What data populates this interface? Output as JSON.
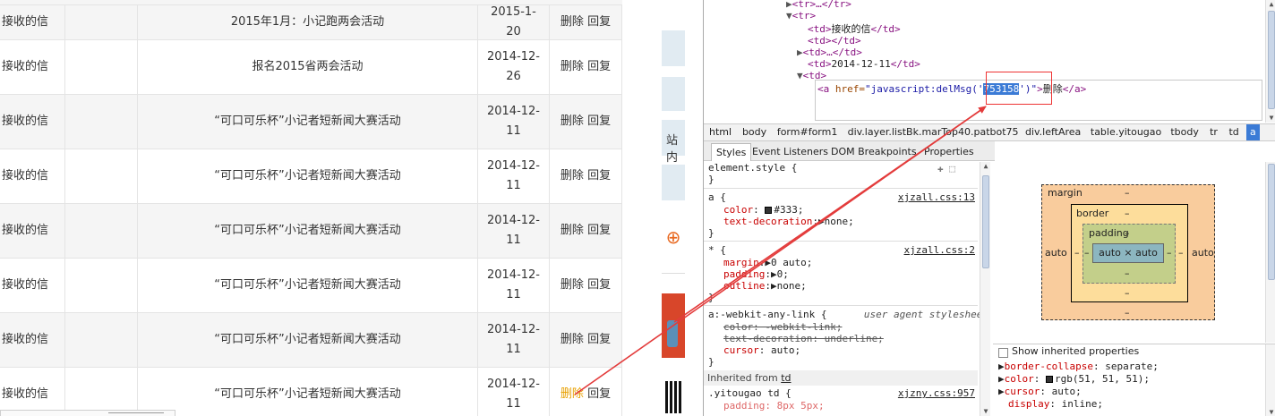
{
  "table": {
    "rows": [
      {
        "type": "接收的信",
        "title": "2015年1月：小记跑两会活动",
        "date": "2015-1-20",
        "delete": "删除",
        "reply": "回复"
      },
      {
        "type": "接收的信",
        "title": "报名2015省两会活动",
        "date": "2014-12-26",
        "delete": "删除",
        "reply": "回复"
      },
      {
        "type": "接收的信",
        "title": "“可口可乐杯”小记者短新闻大赛活动",
        "date": "2014-12-11",
        "delete": "删除",
        "reply": "回复"
      },
      {
        "type": "接收的信",
        "title": "“可口可乐杯”小记者短新闻大赛活动",
        "date": "2014-12-11",
        "delete": "删除",
        "reply": "回复"
      },
      {
        "type": "接收的信",
        "title": "“可口可乐杯”小记者短新闻大赛活动",
        "date": "2014-12-11",
        "delete": "删除",
        "reply": "回复"
      },
      {
        "type": "接收的信",
        "title": "“可口可乐杯”小记者短新闻大赛活动",
        "date": "2014-12-11",
        "delete": "删除",
        "reply": "回复"
      },
      {
        "type": "接收的信",
        "title": "“可口可乐杯”小记者短新闻大赛活动",
        "date": "2014-12-11",
        "delete": "删除",
        "reply": "回复"
      },
      {
        "type": "接收的信",
        "title": "“可口可乐杯”小记者短新闻大赛活动",
        "date": "2014-12-11",
        "delete": "删除",
        "reply": "回复"
      }
    ]
  },
  "side_strip": {
    "text": "站内"
  },
  "devtools": {
    "elements": {
      "line1": "<tr>…</tr>",
      "line2": "<tr>",
      "line3_open": "<td>",
      "line3_text": "接收的信",
      "line3_close": "</td>",
      "line4": "<td></td>",
      "line5": "<td>…</td>",
      "line6_open": "<td>",
      "line6_text": "2014-12-11",
      "line6_close": "</td>",
      "line7": "<td>",
      "sel_tag_open": "<a",
      "sel_attr": " href=",
      "sel_val_pre": "\"javascript:delMsg('",
      "sel_val_id": "753158",
      "sel_val_post": "')\"",
      "sel_gt": ">",
      "sel_text": "删除",
      "sel_close": "</a>"
    },
    "breadcrumbs": [
      "html",
      "body",
      "form#form1",
      "div.layer.listBk.marTop40.patbot75",
      "div.leftArea",
      "table.yitougao",
      "tbody",
      "tr",
      "td",
      "a"
    ],
    "tabs": [
      "Styles",
      "Event Listeners",
      "DOM Breakpoints",
      "Properties"
    ],
    "styles": {
      "element_style": "element.style {",
      "close": "}",
      "rule_a": {
        "selector": "a {",
        "source": "xjzall.css:13",
        "p1_name": "color",
        "p1_val": "#333;",
        "p2_name": "text-decoration",
        "p2_val": "none;"
      },
      "rule_star": {
        "selector": "* {",
        "source": "xjzall.css:2",
        "p1_name": "margin",
        "p1_val": "0 auto;",
        "p2_name": "padding",
        "p2_val": "0;",
        "p3_name": "outline",
        "p3_val": "none;"
      },
      "rule_ua": {
        "selector": "a:-webkit-any-link {",
        "source": "user agent stylesheet",
        "p1": "color: -webkit-link;",
        "p2": "text-decoration: underline;",
        "p3_name": "cursor",
        "p3_val": "auto;"
      },
      "inherited_label": "Inherited from ",
      "inherited_from": "td",
      "rule_yitougao": {
        "selector": ".yitougao td {",
        "source": "xjzny.css:957",
        "p1": "padding: 8px 5px;"
      }
    },
    "metrics": {
      "margin_label": "margin",
      "border_label": "border",
      "padding_label": "padding",
      "dash": "–",
      "auto": "auto",
      "content": "auto × auto"
    },
    "computed": {
      "show_inherited": "Show inherited properties",
      "props": [
        {
          "name": "border-collapse",
          "value": "separate;"
        },
        {
          "name": "color",
          "value": "rgb(51, 51, 51);"
        },
        {
          "name": "cursor",
          "value": "auto;"
        },
        {
          "name": "display",
          "value": "inline;"
        }
      ]
    }
  },
  "colors": {
    "annotation": "#e33b3b",
    "selection": "#3b7bd6",
    "highlight_delete": "#e8a000"
  }
}
